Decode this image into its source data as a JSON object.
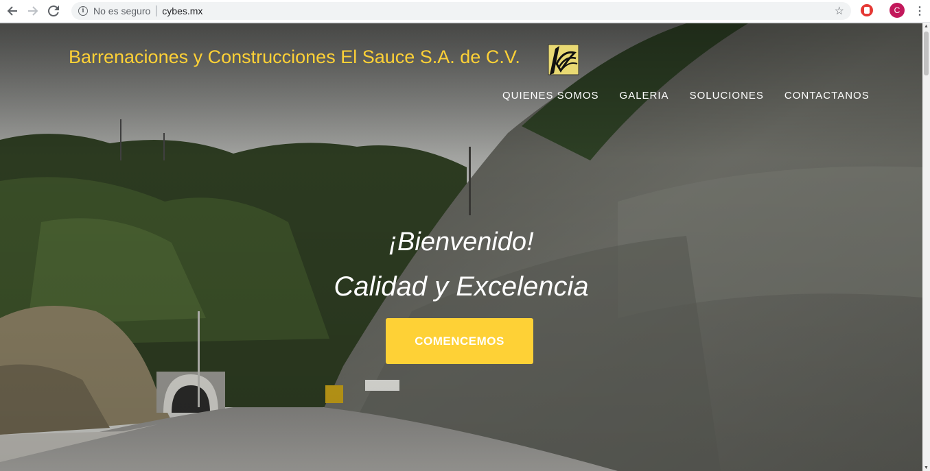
{
  "browser": {
    "security_label": "No es seguro",
    "url": "cybes.mx",
    "profile_initial": "C",
    "icons": [
      "back-arrow-icon",
      "forward-arrow-icon",
      "reload-icon",
      "info-icon",
      "star-icon",
      "extension-icon",
      "menu-dots-icon"
    ]
  },
  "site": {
    "brand": "Barrenaciones y Construcciones El Sauce S.A. de C.V.",
    "brand_color": "#fed136",
    "nav": [
      "QUIENES SOMOS",
      "GALERIA",
      "SOLUCIONES",
      "CONTACTANOS"
    ],
    "hero": {
      "welcome": "¡Bienvenido!",
      "tagline": "Calidad y Excelencia",
      "cta": "COMENCEMOS"
    }
  }
}
